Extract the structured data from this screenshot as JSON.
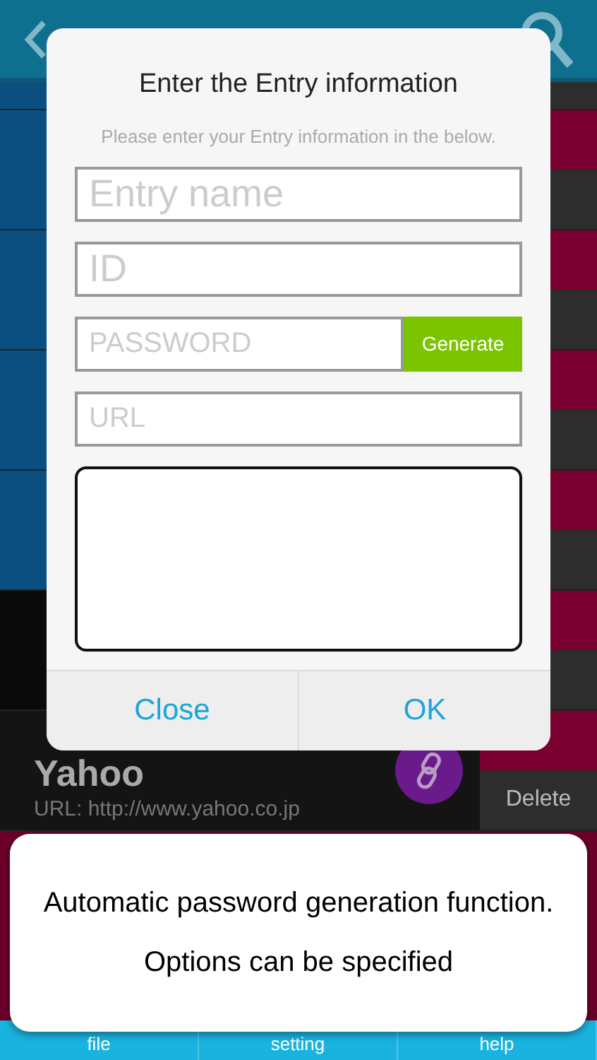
{
  "list": {
    "rows": [
      {
        "kind": "stub",
        "color": "#0b4f80"
      },
      {
        "kind": "entry",
        "color": "#0b4f80"
      },
      {
        "kind": "entry",
        "color": "#0b4f80"
      },
      {
        "kind": "entry",
        "color": "#0b4f80"
      },
      {
        "kind": "entry",
        "color": "#0b4f80"
      },
      {
        "kind": "entry",
        "color": "#0a0a0a"
      },
      {
        "kind": "entry",
        "color": "#141414",
        "title": "Yahoo",
        "url": "URL: http://www.yahoo.co.jp",
        "delete": "Delete"
      }
    ]
  },
  "dialog": {
    "title": "Enter the Entry information",
    "subtitle": "Please enter your Entry information in the below.",
    "fields": [
      {
        "kind": "large",
        "placeholder": "Entry name"
      },
      {
        "kind": "large",
        "placeholder": "ID"
      },
      {
        "kind": "generate",
        "placeholder": "PASSWORD",
        "button": "Generate"
      },
      {
        "kind": "small",
        "placeholder": "URL"
      },
      {
        "kind": "memo"
      }
    ],
    "buttons": [
      "Close",
      "OK"
    ]
  },
  "caption": {
    "lines": [
      "Automatic password generation function.",
      "Options can be specified"
    ]
  },
  "tab_bar": {
    "tabs": [
      "file",
      "setting",
      "help"
    ]
  }
}
